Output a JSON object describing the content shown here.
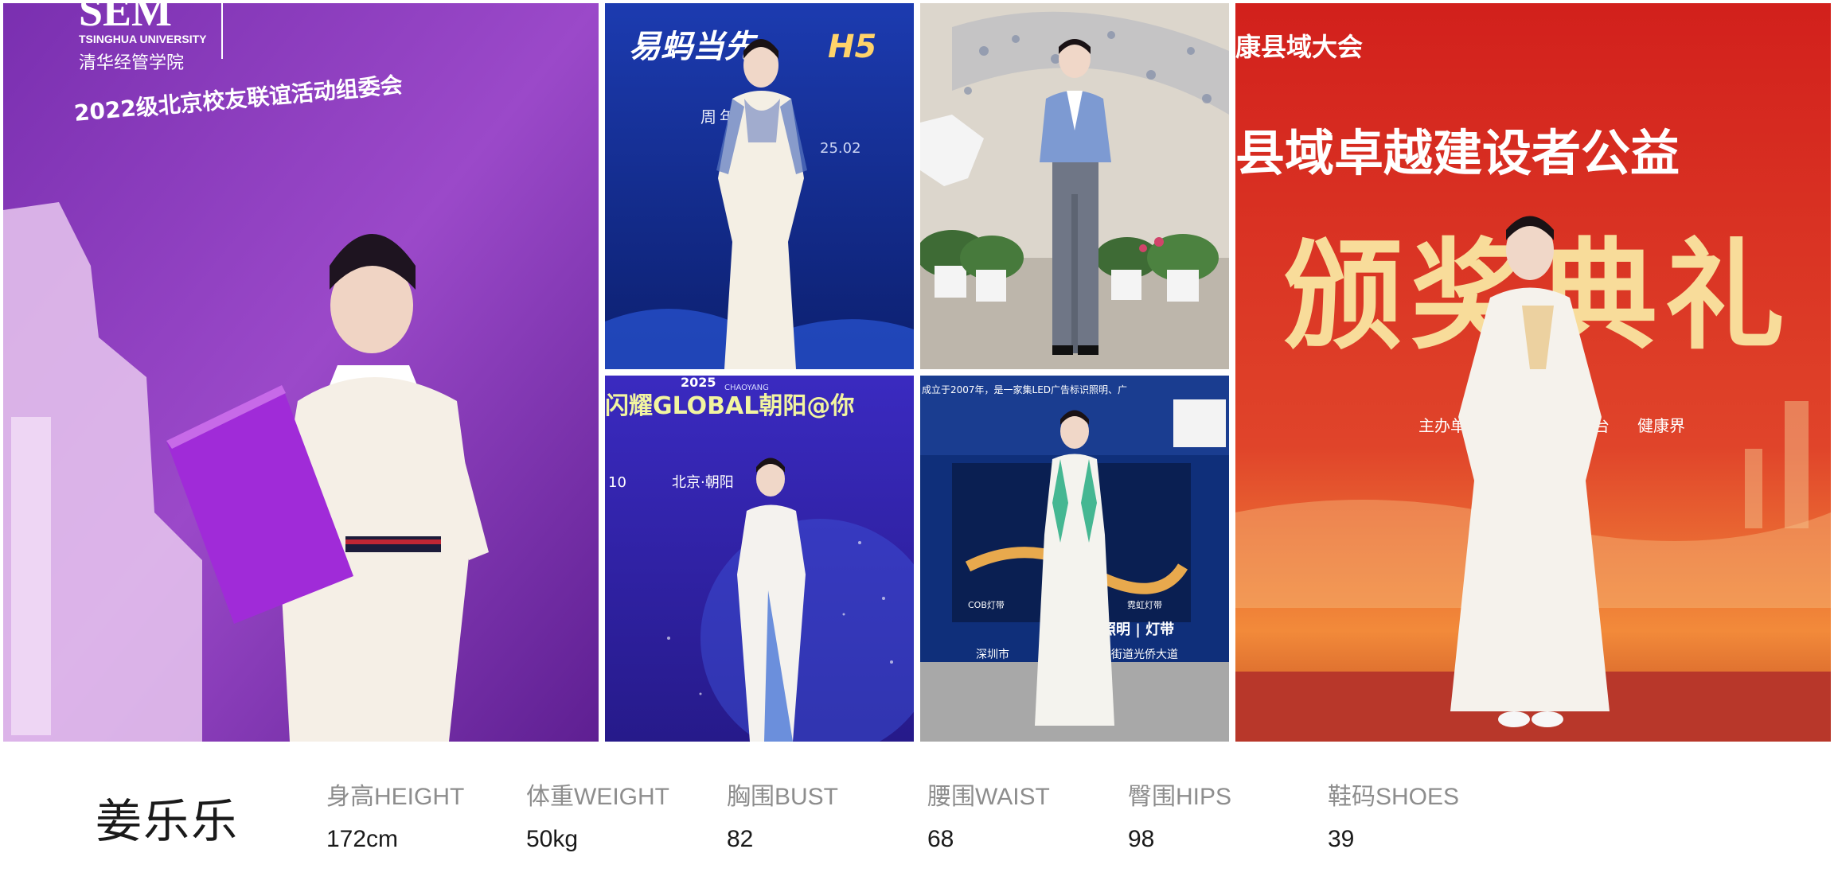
{
  "photos": [
    {
      "texts": [
        "SEM",
        "TSINGHUA UNIVERSITY",
        "清华经管学院",
        "2022级北京校友联谊活动组委会"
      ]
    },
    {
      "texts": [
        "易蚂当先",
        "周年答谢",
        "25.02"
      ]
    },
    {
      "texts": []
    },
    {
      "texts": [
        "2025",
        "CHAOYANG",
        "闪耀GLOBAL朝阳@你",
        "北京·朝阳",
        "10"
      ]
    },
    {
      "texts": [
        "成立于2007年，是一家集LED广告标识照明、广",
        "COB灯带",
        "霓虹灯带",
        "箱照明 | 灯带",
        "深圳市",
        "街道光侨大道"
      ]
    },
    {
      "texts": [
        "康县域大会",
        "县域卓越建设者公益",
        "颁奖典礼",
        "主办单位",
        "播平台",
        "健康界"
      ]
    }
  ],
  "model": {
    "name": "姜乐乐",
    "stats": [
      {
        "label": "身高HEIGHT",
        "value": "172cm"
      },
      {
        "label": "体重WEIGHT",
        "value": "50kg"
      },
      {
        "label": "胸围BUST",
        "value": "82"
      },
      {
        "label": "腰围WAIST",
        "value": "68"
      },
      {
        "label": "臀围HIPS",
        "value": "98"
      },
      {
        "label": "鞋码SHOES",
        "value": "39"
      }
    ]
  }
}
